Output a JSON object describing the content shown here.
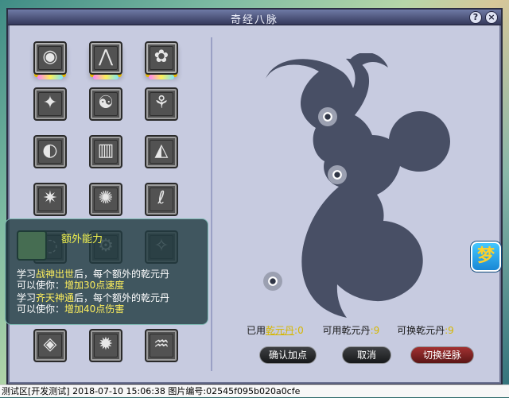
{
  "window": {
    "title": "奇经八脉",
    "help": "?",
    "close": "×"
  },
  "skills": [
    {
      "id": "r1c1",
      "glyph": "◉",
      "glow": true
    },
    {
      "id": "r1c2",
      "glyph": "⋀",
      "glow": true
    },
    {
      "id": "r1c3",
      "glyph": "✿",
      "glow": true
    },
    {
      "id": "r2c1",
      "glyph": "✦",
      "glow": false
    },
    {
      "id": "r2c2",
      "glyph": "☯",
      "glow": false
    },
    {
      "id": "r2c3",
      "glyph": "⚘",
      "glow": false
    },
    {
      "id": "r3c1",
      "glyph": "◐",
      "glow": false
    },
    {
      "id": "r3c2",
      "glyph": "▥",
      "glow": false
    },
    {
      "id": "r3c3",
      "glyph": "◭",
      "glow": false
    },
    {
      "id": "r4c1",
      "glyph": "✷",
      "glow": false
    },
    {
      "id": "r4c2",
      "glyph": "✺",
      "glow": false
    },
    {
      "id": "r4c3",
      "glyph": "ℓ",
      "glow": false
    },
    {
      "id": "r5c1",
      "glyph": "◌",
      "glow": false
    },
    {
      "id": "r5c2",
      "glyph": "⚙",
      "glow": false
    },
    {
      "id": "r5c3",
      "glyph": "✧",
      "glow": false
    },
    {
      "id": "r6c1",
      "glyph": "◈",
      "glow": false
    },
    {
      "id": "r6c2",
      "glyph": "✹",
      "glow": false
    },
    {
      "id": "r6c3",
      "glyph": "♒",
      "glow": false
    }
  ],
  "popup": {
    "title": "额外能力",
    "line1": {
      "a": "学习",
      "b": "战神出世",
      "c": "后，每个额外的乾元丹"
    },
    "line2": {
      "a": "可以使你：",
      "b": "增加30点速度"
    },
    "line3": {
      "a": "学习",
      "b": "齐天神通",
      "c": "后，每个额外的乾元丹"
    },
    "line4": {
      "a": "可以使你：",
      "b": "增加40点伤害"
    }
  },
  "summary": {
    "used_label": "已用",
    "used_link": "乾元丹",
    "used_value": ":0",
    "available_label": "可用乾元丹",
    "available_value": ":9",
    "swap_label": "可换乾元丹",
    "swap_value": ":9"
  },
  "buttons": {
    "confirm": "确认加点",
    "cancel": "取消",
    "switch": "切换经脉"
  },
  "status_bar": {
    "text": "测试区[开发测试] 2018-07-10 15:06:38 图片编号:02545f095b020a0cfe"
  },
  "side_icon": {
    "label": "梦"
  }
}
